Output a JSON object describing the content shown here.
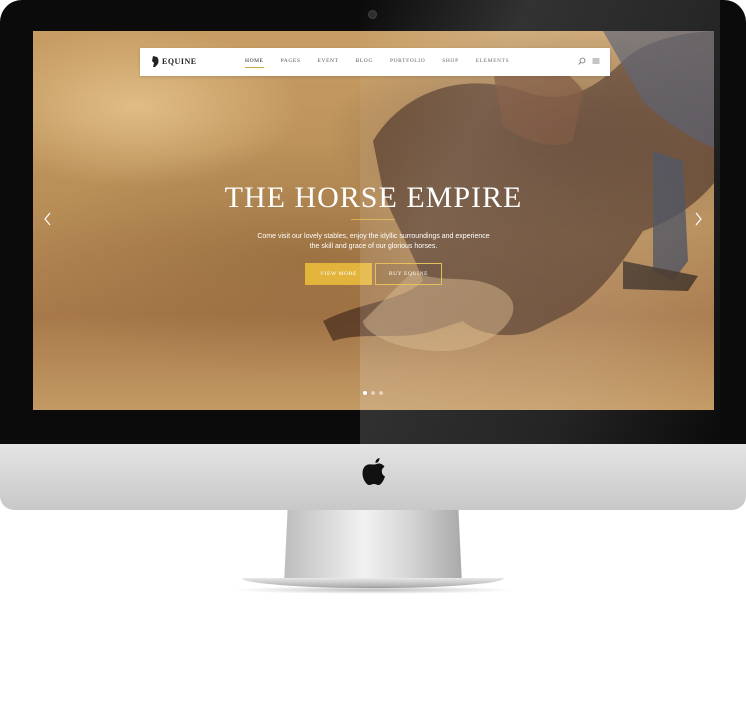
{
  "site": {
    "logo_text": "EQUINE"
  },
  "nav": {
    "items": [
      {
        "label": "HOME",
        "active": true
      },
      {
        "label": "PAGES",
        "active": false
      },
      {
        "label": "EVENT",
        "active": false
      },
      {
        "label": "BLOG",
        "active": false
      },
      {
        "label": "PORTFOLIO",
        "active": false
      },
      {
        "label": "SHOP",
        "active": false
      },
      {
        "label": "ELEMENTS",
        "active": false
      }
    ],
    "icons": [
      "search-icon",
      "menu-icon"
    ]
  },
  "hero": {
    "title": "THE HORSE EMPIRE",
    "text": "Come visit our lovely stables, enjoy the idyllic surroundings and experience the skill and grace of our glorious horses.",
    "primary_button": "VIEW MORE",
    "secondary_button": "BUY EQUINE"
  },
  "slider": {
    "slide_count": 3,
    "active_slide": 1
  },
  "colors": {
    "accent": "#e2b43c",
    "frame": "#0b0b0b",
    "chin": "#d6d6d6"
  }
}
